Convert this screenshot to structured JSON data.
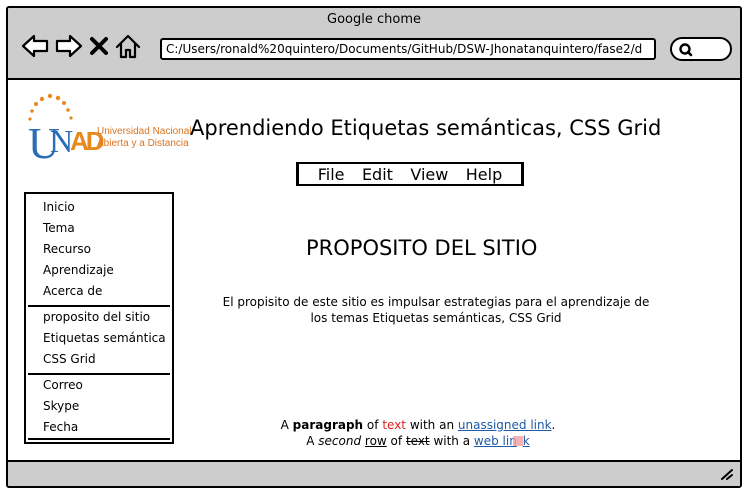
{
  "browser": {
    "title": "Google chome",
    "address": "C:/Users/ronald%20quintero/Documents/GitHub/DSW-Jhonatanquintero/fase2/d",
    "icons": [
      "back-arrow-icon",
      "forward-arrow-icon",
      "close-x-icon",
      "home-icon",
      "search-icon",
      "resize-grip-icon"
    ]
  },
  "logo": {
    "letters": "UNAD",
    "line1": "Universidad Nacional",
    "line2": "Abierta y a Distancia"
  },
  "page": {
    "title": "Aprendiendo Etiquetas semánticas, CSS Grid"
  },
  "menu": [
    "File",
    "Edit",
    "View",
    "Help"
  ],
  "sidebar": {
    "group1": [
      "Inicio",
      "Tema",
      "Recurso",
      "Aprendizaje",
      "Acerca de"
    ],
    "group2": [
      "proposito del sitio",
      "Etiquetas semántica",
      "CSS Grid"
    ],
    "group3": [
      "Correo",
      "Skype",
      "Fecha"
    ]
  },
  "main": {
    "heading": "PROPOSITO DEL SITIO",
    "description": "El propisito de este sitio es impulsar estrategias para el aprendizaje de los temas Etiquetas semánticas, CSS Grid"
  },
  "paragraph1": {
    "a": "A ",
    "b": "paragraph",
    "c": " of ",
    "d": "text",
    "e": " with an ",
    "f": "unassigned link",
    "g": "."
  },
  "paragraph2": {
    "a": "A ",
    "b": "second",
    "c": " ",
    "d": "row",
    "e": " of ",
    "f": "text",
    "g": " with a ",
    "h": "web lin",
    "i": "k"
  },
  "colors": {
    "chrome": "#cdcdcd",
    "red_text": "#e02020",
    "link": "#1f5aa6",
    "logo_blue": "#2c6db5",
    "logo_orange": "#e8891c"
  }
}
